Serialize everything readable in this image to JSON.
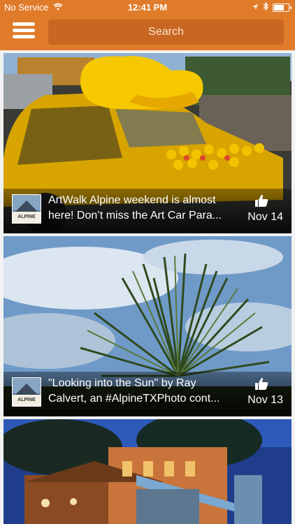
{
  "status": {
    "carrier": "No Service",
    "time": "12:41 PM",
    "battery_level": 0.7
  },
  "nav": {
    "search_label": "Search",
    "menu_icon": "hamburger-menu-icon"
  },
  "feed": [
    {
      "title": "ArtWalk Alpine weekend is almost here! Don’t miss the Art Car Para...",
      "date": "Nov 14",
      "thumb_text": "ALPINE"
    },
    {
      "title": "\"Looking into the Sun\" by Ray Calvert, an #AlpineTXPhoto cont...",
      "date": "Nov 13",
      "thumb_text": "ALPINE"
    }
  ],
  "colors": {
    "accent": "#e07b2a",
    "search_bg": "#c86622"
  }
}
